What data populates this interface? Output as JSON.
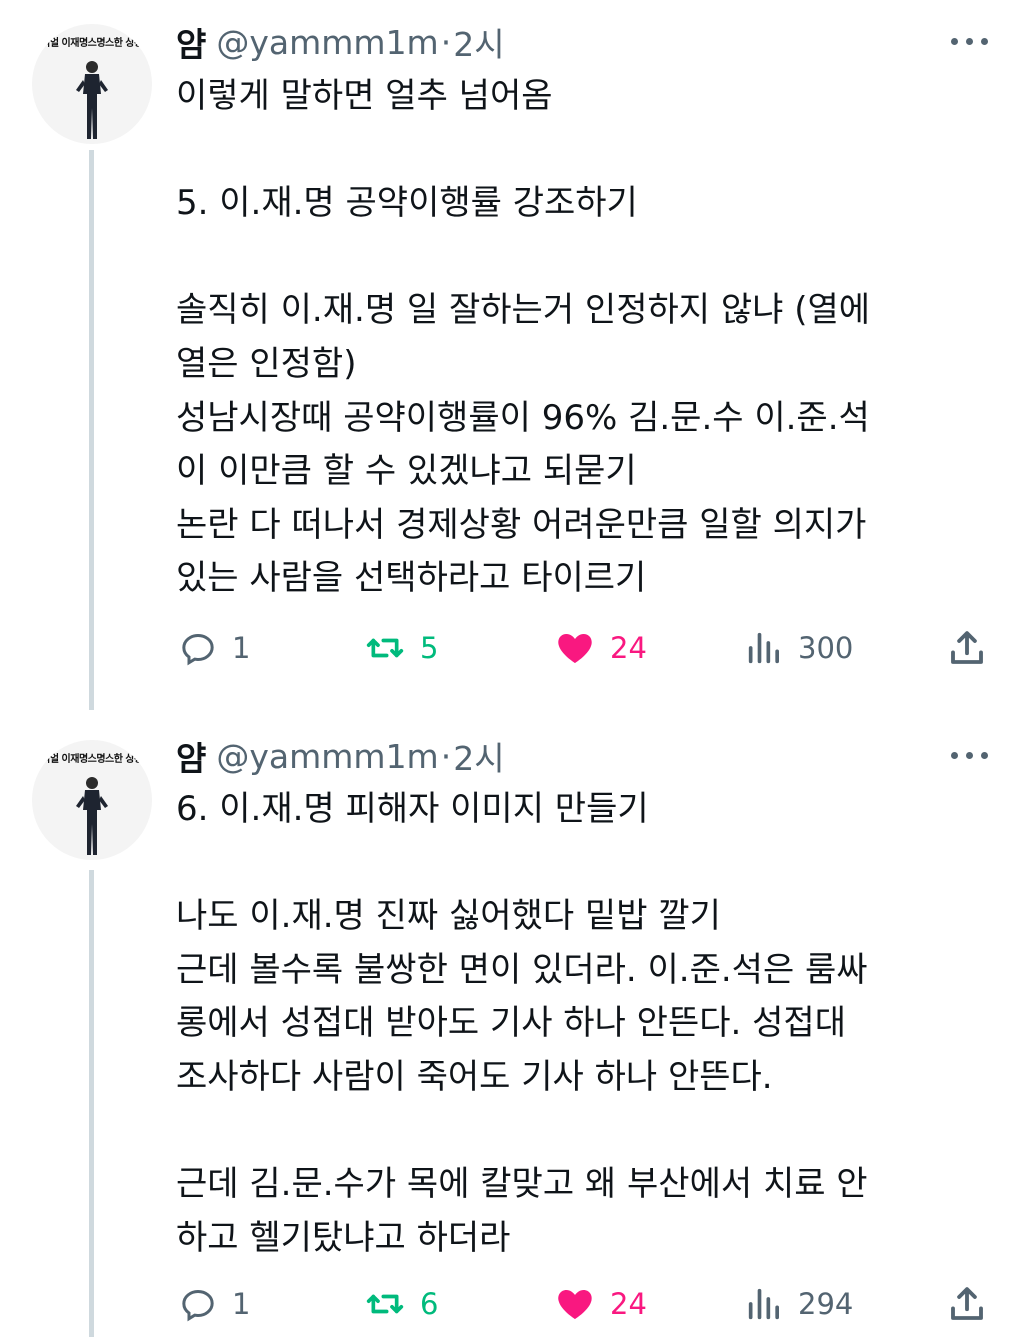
{
  "tweets": [
    {
      "author": {
        "name": "얌",
        "handle": "@yammm1m",
        "avatar_caption": "리얼 이재명스명스한 상황"
      },
      "separator": "·",
      "time": "2시",
      "lines": [
        "이렇게 말하면 얼추 넘어옴",
        "",
        "5. 이.재.명 공약이행률 강조하기",
        "",
        "솔직히 이.재.명 일 잘하는거 인정하지 않냐 (열에",
        "열은 인정함)",
        "성남시장때 공약이행률이 96% 김.문.수 이.준.석",
        "이 이만큼 할 수 있겠냐고 되묻기",
        "논란 다 떠나서 경제상황 어려운만큼 일할 의지가",
        "있는 사람을 선택하라고 타이르기"
      ],
      "stats": {
        "replies": "1",
        "retweets": "5",
        "likes": "24",
        "views": "300"
      }
    },
    {
      "author": {
        "name": "얌",
        "handle": "@yammm1m",
        "avatar_caption": "리얼 이재명스명스한 상황"
      },
      "separator": "·",
      "time": "2시",
      "lines": [
        "6. 이.재.명 피해자 이미지 만들기",
        "",
        "나도 이.재.명 진짜 싫어했다 밑밥 깔기",
        "근데 볼수록 불쌍한 면이 있더라. 이.준.석은 룸싸",
        "롱에서 성접대 받아도 기사 하나 안뜬다. 성접대",
        "조사하다 사람이 죽어도 기사 하나 안뜬다.",
        "",
        "근데 김.문.수가 목에 칼맞고 왜 부산에서 치료 안",
        "하고 헬기탔냐고 하더라"
      ],
      "stats": {
        "replies": "1",
        "retweets": "6",
        "likes": "24",
        "views": "294"
      }
    }
  ],
  "icons": {
    "reply": "reply-icon",
    "retweet": "retweet-icon",
    "like": "heart-icon",
    "views": "views-icon",
    "share": "share-icon",
    "more": "more-icon"
  },
  "colors": {
    "text": "#0f1419",
    "secondary": "#536471",
    "retweet": "#00ba7c",
    "like": "#f91880",
    "thread_line": "#cfd9de"
  }
}
